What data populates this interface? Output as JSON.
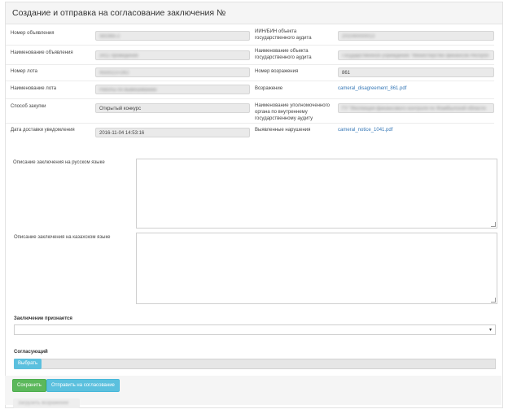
{
  "header": {
    "title": "Создание и отправка на согласование заключения №"
  },
  "info": {
    "announcement_number": {
      "label": "Номер объявления",
      "value": "381985-2"
    },
    "iin_bin": {
      "label": "ИИН/БИН объекта государственного аудита",
      "value": "201040000013"
    },
    "announcement_name": {
      "label": "Наименование объявления",
      "value": "3411 проведение"
    },
    "audit_object_name": {
      "label": "Наименование объекта государственного аудита",
      "value": "Государственное учреждение \"Министерство финансов Республ"
    },
    "lot_number": {
      "label": "Номер лота",
      "value": "4559113-ОК2"
    },
    "objection_number": {
      "label": "Номер возражения",
      "value": "861"
    },
    "lot_name": {
      "label": "Наименование лота",
      "value": "Работы по вывешиванию"
    },
    "objection": {
      "label": "Возражение",
      "value": "cameral_disagreement_861.pdf"
    },
    "purchase_method": {
      "label": "Способ закупки",
      "value": "Открытый конкурс"
    },
    "authorized_body": {
      "label": "Наименование уполномоченного органа по внутреннему государственному аудиту",
      "value": "ГУ \"Инспекция финансового контроля по Жамбылской области"
    },
    "delivery_date": {
      "label": "Дата доставки уведомления",
      "value": "2016-11-04 14:53:16"
    },
    "violations": {
      "label": "Выявленные нарушения",
      "value": "cameral_notice_1041.pdf"
    }
  },
  "form": {
    "desc_ru_label": "Описание заключения на русском языке",
    "desc_kz_label": "Описание заключения на казахском языке",
    "conclusion_label": "Заключение признается",
    "conclusion_value": "",
    "approver_label": "Согласующий",
    "pick_button": "Выбрать"
  },
  "actions": {
    "save": "Сохранить",
    "send": "Отправить на согласование",
    "extra": "Загрузить возражение"
  }
}
